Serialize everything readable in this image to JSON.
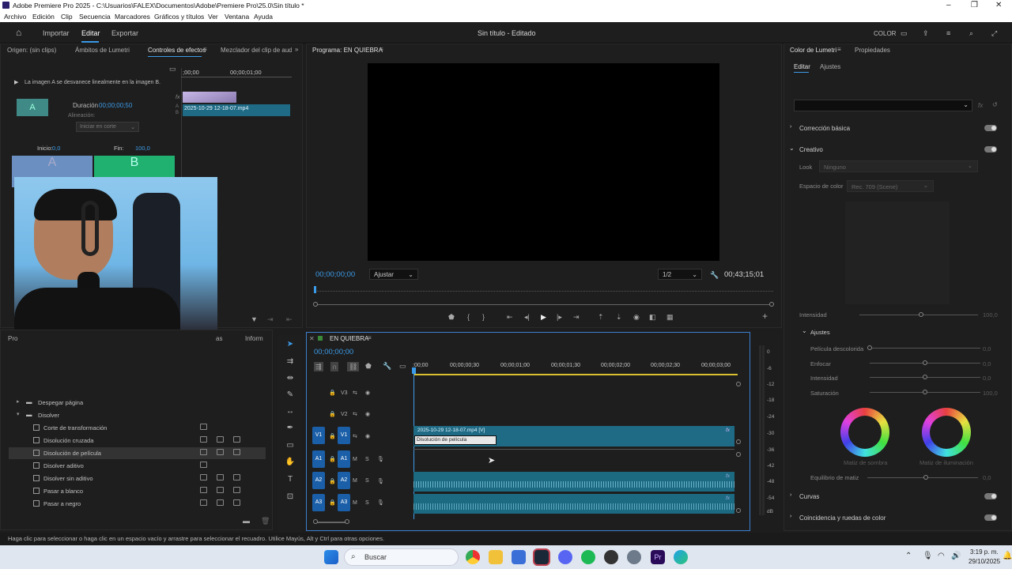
{
  "window": {
    "title": "Adobe Premiere Pro 2025 - C:\\Usuarios\\FALEX\\Documentos\\Adobe\\Premiere Pro\\25.0\\Sin título *"
  },
  "menu": [
    "Archivo",
    "Edición",
    "Clip",
    "Secuencia",
    "Marcadores",
    "Gráficos y títulos",
    "Ver",
    "Ventana",
    "Ayuda"
  ],
  "appbar": {
    "nav": [
      "Importar",
      "Editar",
      "Exportar"
    ],
    "center_title": "Sin título - Editado",
    "color_label": "COLOR"
  },
  "left_panel": {
    "tabs": [
      "Origen: (sin clips)",
      "Ámbitos de Lumetri",
      "Controles de efectos",
      "Mezclador del clip de audio"
    ],
    "description": "La imagen A se desvanece linealmente en la imagen B.",
    "duration_label": "Duración",
    "duration_value": "00;00;00;50",
    "alignment_label": "Alineación:",
    "alignment_value": "Iniciar en corte",
    "start_label": "Inicio:",
    "start_value": "0,0",
    "end_label": "Fin:",
    "end_value": "100,0",
    "timecode": "00;00;01;00",
    "timecode_start": ";00;00",
    "clip_name": "2025-10-29 12-18-07.mp4",
    "thumb_a": "A",
    "thumb_b": "B",
    "row_labels": [
      "A",
      "B"
    ],
    "fx_label": "fx"
  },
  "project_panel": {
    "tab_partial": "Pro",
    "tab_right": "Inform",
    "tab_right2": "as",
    "folders": [
      {
        "label": "Despegar página",
        "expanded": false
      },
      {
        "label": "Disolver",
        "expanded": true
      }
    ],
    "items": [
      {
        "label": "Corte de transformación",
        "icons": 1
      },
      {
        "label": "Disolución cruzada",
        "icons": 3
      },
      {
        "label": "Disolución de película",
        "icons": 3,
        "selected": true
      },
      {
        "label": "Disolver aditivo",
        "icons": 1
      },
      {
        "label": "Disolver sin aditivo",
        "icons": 3
      },
      {
        "label": "Pasar a blanco",
        "icons": 3
      },
      {
        "label": "Pasar a negro",
        "icons": 3
      }
    ]
  },
  "program_monitor": {
    "tab": "Programa: EN QUIEBRA",
    "timecode": "00;00;00;00",
    "fit": "Ajustar",
    "resolution": "1/2",
    "duration": "00;43;15;01"
  },
  "timeline": {
    "tab": "EN QUIEBRA",
    "timecode": "00;00;00;00",
    "ruler": [
      ":00;00",
      "00;00;00;30",
      "00;00;01;00",
      "00;00;01;30",
      "00;00;02;00",
      "00;00;02;30",
      "00;00;03;00"
    ],
    "tracks": [
      {
        "id": "V3",
        "type": "video"
      },
      {
        "id": "V2",
        "type": "video"
      },
      {
        "id": "V1",
        "type": "video",
        "src": "V1"
      },
      {
        "id": "A1",
        "type": "audio",
        "src": "A1"
      },
      {
        "id": "A2",
        "type": "audio",
        "src": "A2"
      },
      {
        "id": "A3",
        "type": "audio",
        "src": "A3"
      }
    ],
    "mute": "M",
    "solo": "S",
    "clip_label": "2025-10-29 12-18-07.mp4 [V]",
    "transition_label": "Disolución de película",
    "fx_label": "fx",
    "meter_labels": [
      "0",
      "-6",
      "-12",
      "-18",
      "-24",
      "-30",
      "-36",
      "-42",
      "-48",
      "-54",
      "dB"
    ]
  },
  "lumetri": {
    "tabs": [
      "Color de Lumetri",
      "Propiedades"
    ],
    "subtabs": [
      "Editar",
      "Ajustes"
    ],
    "fx_label": "fx",
    "sections": [
      {
        "label": "Corrección básica",
        "expanded": false
      },
      {
        "label": "Creativo",
        "expanded": true
      }
    ],
    "look_label": "Look",
    "look_value": "Ninguno",
    "colorspace_label": "Espacio de color",
    "colorspace_value": "Rec. 709 (Scene)",
    "intensity_label": "Intensidad",
    "intensity_value": "100,0",
    "adjustments_label": "Ajustes",
    "sliders": [
      {
        "label": "Película descolorida",
        "value": "0,0",
        "pos": 0.0
      },
      {
        "label": "Enfocar",
        "value": "0,0",
        "pos": 0.5
      },
      {
        "label": "Intensidad",
        "value": "0,0",
        "pos": 0.5
      },
      {
        "label": "Saturación",
        "value": "100,0",
        "pos": 0.5
      }
    ],
    "wheel_shadow": "Matiz de sombra",
    "wheel_highlight": "Matiz de iluminación",
    "hue_balance_label": "Equilibrio de matiz",
    "hue_balance_value": "0,0",
    "bottom_sections": [
      "Curvas",
      "Coincidencia y ruedas de color"
    ]
  },
  "status_bar": "Haga clic para seleccionar o haga clic en un espacio vacío y arrastre para seleccionar el recuadro. Utilice Mayús, Alt y Ctrl para otras opciones.",
  "taskbar": {
    "search": "Buscar",
    "time": "3:19 p. m.",
    "date": "29/10/2025"
  },
  "colors": {
    "accent_blue": "#3c9be8",
    "clip_teal": "#1f6b85",
    "audio_teal": "#1c6a82",
    "track_blue": "#1b5fa8"
  }
}
